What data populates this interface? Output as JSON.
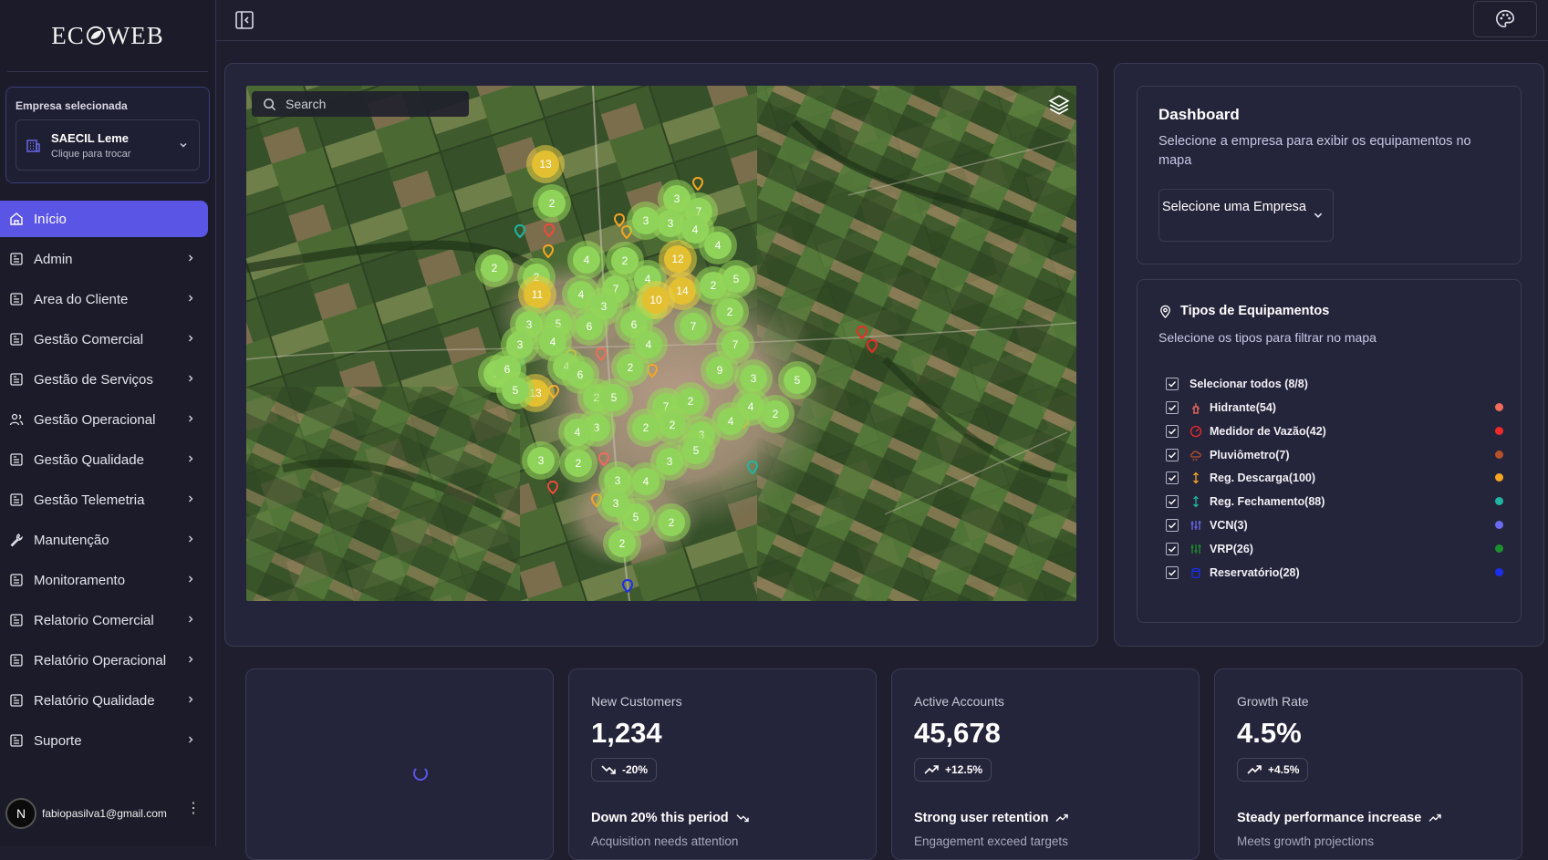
{
  "app": {
    "logo_left": "EC",
    "logo_right": "WEB"
  },
  "company": {
    "section_label": "Empresa selecionada",
    "name": "SAECIL Leme",
    "hint": "Clique para trocar"
  },
  "nav": [
    {
      "label": "Início",
      "active": true,
      "icon": "home-icon"
    },
    {
      "label": "Admin",
      "icon": "page-icon"
    },
    {
      "label": "Area do Cliente",
      "icon": "page-icon"
    },
    {
      "label": "Gestão Comercial",
      "icon": "page-icon"
    },
    {
      "label": "Gestão de Serviços",
      "icon": "page-icon"
    },
    {
      "label": "Gestão Operacional",
      "icon": "users-icon"
    },
    {
      "label": "Gestão Qualidade",
      "icon": "page-icon"
    },
    {
      "label": "Gestão Telemetria",
      "icon": "page-icon"
    },
    {
      "label": "Manutenção",
      "icon": "wrench-icon"
    },
    {
      "label": "Monitoramento",
      "icon": "page-icon"
    },
    {
      "label": "Relatorio Comercial",
      "icon": "page-icon"
    },
    {
      "label": "Relatório Operacional",
      "icon": "page-icon"
    },
    {
      "label": "Relatório Qualidade",
      "icon": "page-icon"
    },
    {
      "label": "Suporte",
      "icon": "page-icon"
    }
  ],
  "user": {
    "avatar_letter": "N",
    "email": "fabiopasilva1@gmail.com"
  },
  "map": {
    "search_placeholder": "Search",
    "clusters": [
      {
        "n": "13",
        "c": "y"
      },
      {
        "n": "2",
        "c": "g"
      },
      {
        "n": "3",
        "c": "g"
      },
      {
        "n": "7",
        "c": "g"
      },
      {
        "n": "3",
        "c": "g"
      },
      {
        "n": "3",
        "c": "g"
      },
      {
        "n": "4",
        "c": "g"
      },
      {
        "n": "4",
        "c": "g"
      },
      {
        "n": "2",
        "c": "g"
      },
      {
        "n": "2",
        "c": "g"
      },
      {
        "n": "4",
        "c": "g"
      },
      {
        "n": "2",
        "c": "g"
      },
      {
        "n": "12",
        "c": "y"
      },
      {
        "n": "11",
        "c": "y"
      },
      {
        "n": "4",
        "c": "g"
      },
      {
        "n": "7",
        "c": "g"
      },
      {
        "n": "4",
        "c": "g"
      },
      {
        "n": "14",
        "c": "y"
      },
      {
        "n": "2",
        "c": "g"
      },
      {
        "n": "5",
        "c": "g"
      },
      {
        "n": "3",
        "c": "g"
      },
      {
        "n": "5",
        "c": "g"
      },
      {
        "n": "10",
        "c": "y"
      },
      {
        "n": "2",
        "c": "g"
      },
      {
        "n": "3",
        "c": "g"
      },
      {
        "n": "5",
        "c": "g"
      },
      {
        "n": "6",
        "c": "g"
      },
      {
        "n": "6",
        "c": "g"
      },
      {
        "n": "7",
        "c": "g"
      },
      {
        "n": "3",
        "c": "g"
      },
      {
        "n": "4",
        "c": "g"
      },
      {
        "n": "4",
        "c": "g"
      },
      {
        "n": "7",
        "c": "g"
      },
      {
        "n": "2",
        "c": "g"
      },
      {
        "n": "3",
        "c": "g"
      },
      {
        "n": "6",
        "c": "g"
      },
      {
        "n": "4",
        "c": "g"
      },
      {
        "n": "6",
        "c": "g"
      },
      {
        "n": "13",
        "c": "y"
      },
      {
        "n": "5",
        "c": "g"
      },
      {
        "n": "5",
        "c": "g"
      },
      {
        "n": "3",
        "c": "g"
      },
      {
        "n": "9",
        "c": "g"
      },
      {
        "n": "7",
        "c": "g"
      },
      {
        "n": "2",
        "c": "g"
      },
      {
        "n": "4",
        "c": "g"
      },
      {
        "n": "2",
        "c": "g"
      },
      {
        "n": "5",
        "c": "g"
      },
      {
        "n": "4",
        "c": "g"
      },
      {
        "n": "2",
        "c": "g"
      },
      {
        "n": "2",
        "c": "g"
      },
      {
        "n": "3",
        "c": "g"
      },
      {
        "n": "3",
        "c": "g"
      },
      {
        "n": "4",
        "c": "g"
      },
      {
        "n": "2",
        "c": "g"
      },
      {
        "n": "3",
        "c": "g"
      },
      {
        "n": "3",
        "c": "g"
      },
      {
        "n": "2",
        "c": "g"
      },
      {
        "n": "5",
        "c": "g"
      },
      {
        "n": "3",
        "c": "g"
      },
      {
        "n": "4",
        "c": "g"
      },
      {
        "n": "5",
        "c": "g"
      },
      {
        "n": "2",
        "c": "g"
      },
      {
        "n": "3",
        "c": "g"
      },
      {
        "n": "2",
        "c": "g"
      }
    ]
  },
  "dashboard": {
    "title": "Dashboard",
    "subtitle": "Selecione a empresa para exibir os equipamentos no mapa",
    "select_label": "Selecione uma Empresa"
  },
  "equipment": {
    "title": "Tipos de Equipamentos",
    "subtitle": "Selecione os tipos para filtrar no mapa",
    "select_all": "Selecionar todos (8/8)",
    "types": [
      {
        "label": "Hidrante(54)",
        "color": "#f26b5b",
        "icon": "hydrant-icon"
      },
      {
        "label": "Medidor de Vazão(42)",
        "color": "#ee2a2a",
        "icon": "gauge-icon"
      },
      {
        "label": "Pluviômetro(7)",
        "color": "#b4512a",
        "icon": "cloud-rain-icon"
      },
      {
        "label": "Reg. Descarga(100)",
        "color": "#f5a623",
        "icon": "arrows-vertical-icon"
      },
      {
        "label": "Reg. Fechamento(88)",
        "color": "#1fb5a3",
        "icon": "arrows-vertical-icon"
      },
      {
        "label": "VCN(3)",
        "color": "#6b6bef",
        "icon": "sliders-icon"
      },
      {
        "label": "VRP(26)",
        "color": "#1e8f2e",
        "icon": "sliders-icon"
      },
      {
        "label": "Reservatório(28)",
        "color": "#1a2ef0",
        "icon": "tank-icon"
      }
    ]
  },
  "stats": [
    {
      "label": "New Customers",
      "value": "1,234",
      "badge": "-20%",
      "trend": "down",
      "foot": "Down 20% this period",
      "foot2": "Acquisition needs attention"
    },
    {
      "label": "Active Accounts",
      "value": "45,678",
      "badge": "+12.5%",
      "trend": "up",
      "foot": "Strong user retention",
      "foot2": "Engagement exceed targets"
    },
    {
      "label": "Growth Rate",
      "value": "4.5%",
      "badge": "+4.5%",
      "trend": "up",
      "foot": "Steady performance increase",
      "foot2": "Meets growth projections"
    }
  ]
}
